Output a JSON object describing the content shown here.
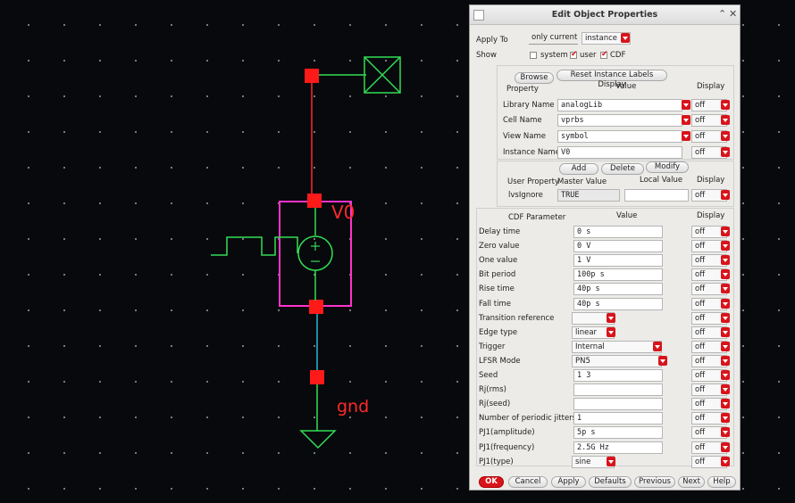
{
  "schematic": {
    "instance_label": "V0",
    "ground_label": "gnd"
  },
  "dialog": {
    "title": "Edit Object Properties",
    "apply_to_label": "Apply To",
    "apply_scope": "only current",
    "apply_target": "instance",
    "show_label": "Show",
    "show_options": [
      {
        "label": "system",
        "checked": false
      },
      {
        "label": "user",
        "checked": true
      },
      {
        "label": "CDF",
        "checked": true
      }
    ],
    "browse_label": "Browse",
    "reset_label": "Reset Instance Labels Display",
    "prop_header": {
      "property": "Property",
      "value": "Value",
      "display": "Display"
    },
    "properties": [
      {
        "label": "Library Name",
        "value": "analogLib",
        "display": "off",
        "dropdown": true
      },
      {
        "label": "Cell Name",
        "value": "vprbs",
        "display": "off",
        "dropdown": true
      },
      {
        "label": "View Name",
        "value": "symbol",
        "display": "off",
        "dropdown": true
      },
      {
        "label": "Instance Name",
        "value": "V0",
        "display": "off",
        "dropdown": false
      }
    ],
    "add_label": "Add",
    "delete_label": "Delete",
    "modify_label": "Modify",
    "user_header": {
      "user_property": "User Property",
      "master": "Master Value",
      "local": "Local Value",
      "display": "Display"
    },
    "user_row": {
      "label": "lvsIgnore",
      "master": "TRUE",
      "local": "",
      "display": "off"
    },
    "cdf_header": {
      "param": "CDF Parameter",
      "value": "Value",
      "display": "Display"
    },
    "cdf_params": [
      {
        "label": "Delay time",
        "value": "0 s",
        "kind": "field",
        "display": "off"
      },
      {
        "label": "Zero value",
        "value": "0 V",
        "kind": "field",
        "display": "off"
      },
      {
        "label": "One value",
        "value": "1 V",
        "kind": "field",
        "display": "off"
      },
      {
        "label": "Bit period",
        "value": "100p s",
        "kind": "field",
        "display": "off"
      },
      {
        "label": "Rise time",
        "value": "40p s",
        "kind": "field",
        "display": "off"
      },
      {
        "label": "Fall time",
        "value": "40p s",
        "kind": "field",
        "display": "off"
      },
      {
        "label": "Transition reference",
        "value": "",
        "kind": "combo-short",
        "display": "off"
      },
      {
        "label": "Edge type",
        "value": "linear",
        "kind": "combo-short",
        "display": "off"
      },
      {
        "label": "Trigger",
        "value": "Internal",
        "kind": "combo",
        "display": "off"
      },
      {
        "label": "LFSR Mode",
        "value": "PN5",
        "kind": "combo",
        "display": "off"
      },
      {
        "label": "Seed",
        "value": "1 3",
        "kind": "field",
        "display": "off"
      },
      {
        "label": "Rj(rms)",
        "value": "",
        "kind": "field",
        "display": "off"
      },
      {
        "label": "Rj(seed)",
        "value": "",
        "kind": "field",
        "display": "off"
      },
      {
        "label": "Number of periodic jitters",
        "value": "1",
        "kind": "field",
        "display": "off"
      },
      {
        "label": "PJ1(amplitude)",
        "value": "5p s",
        "kind": "field",
        "display": "off"
      },
      {
        "label": "PJ1(frequency)",
        "value": "2.5G Hz",
        "kind": "field",
        "display": "off"
      },
      {
        "label": "PJ1(type)",
        "value": "sine",
        "kind": "combo-short",
        "display": "off"
      }
    ],
    "footer": {
      "ok": "OK",
      "cancel": "Cancel",
      "apply": "Apply",
      "defaults": "Defaults",
      "previous": "Previous",
      "next": "Next",
      "help": "Help"
    },
    "accent_color": "#d8141b"
  }
}
